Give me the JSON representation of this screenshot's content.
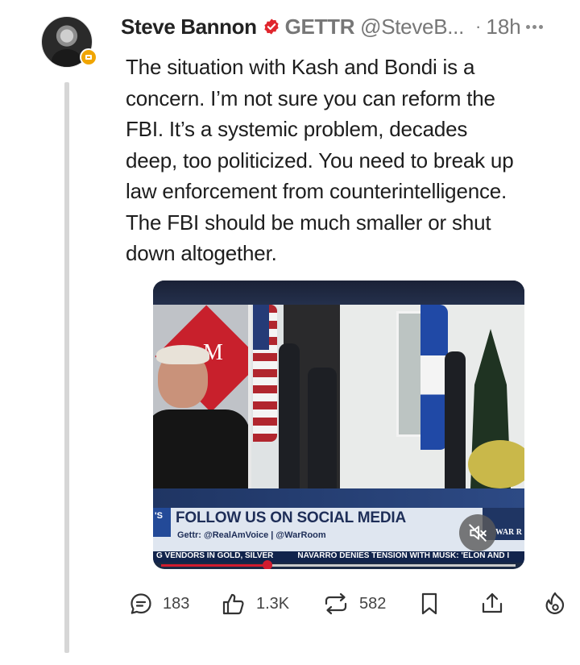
{
  "post": {
    "author": {
      "display_name": "Steve Bannon",
      "platform_label": "GETTR",
      "handle": "@SteveB...",
      "avatar_icon": "profile-photo",
      "badge_icon": "gold-medal-badge"
    },
    "timestamp": "18h",
    "separator": "·",
    "text": "The situation with Kash and Bondi is a\nconcern. I’m not sure you can reform the\nFBI. It’s a systemic problem, decades\ndeep, too politicized. You need to break up\nlaw enforcement from counterintelligence.\nThe FBI should be much smaller or shut\ndown altogether."
  },
  "video": {
    "tag": "'S",
    "lower_third_title": "FOLLOW US ON SOCIAL MEDIA",
    "lower_third_subtitle": "Gettr: @RealAmVoice | @WarRoom",
    "logo_text": "WAR R",
    "ticker_left": "G VENDORS IN GOLD, SILVER",
    "ticker_right": "NAVARRO DENIES TENSION WITH MUSK: 'ELON AND I",
    "progress": 0.3,
    "muted": true,
    "mute_icon": "speaker-muted-icon"
  },
  "actions": {
    "comments": "183",
    "likes": "1.3K",
    "reposts": "582"
  },
  "colors": {
    "brand_red": "#e0262d",
    "text": "#1d1d1d",
    "muted_text": "#777777",
    "progress": "#d11b2e"
  }
}
